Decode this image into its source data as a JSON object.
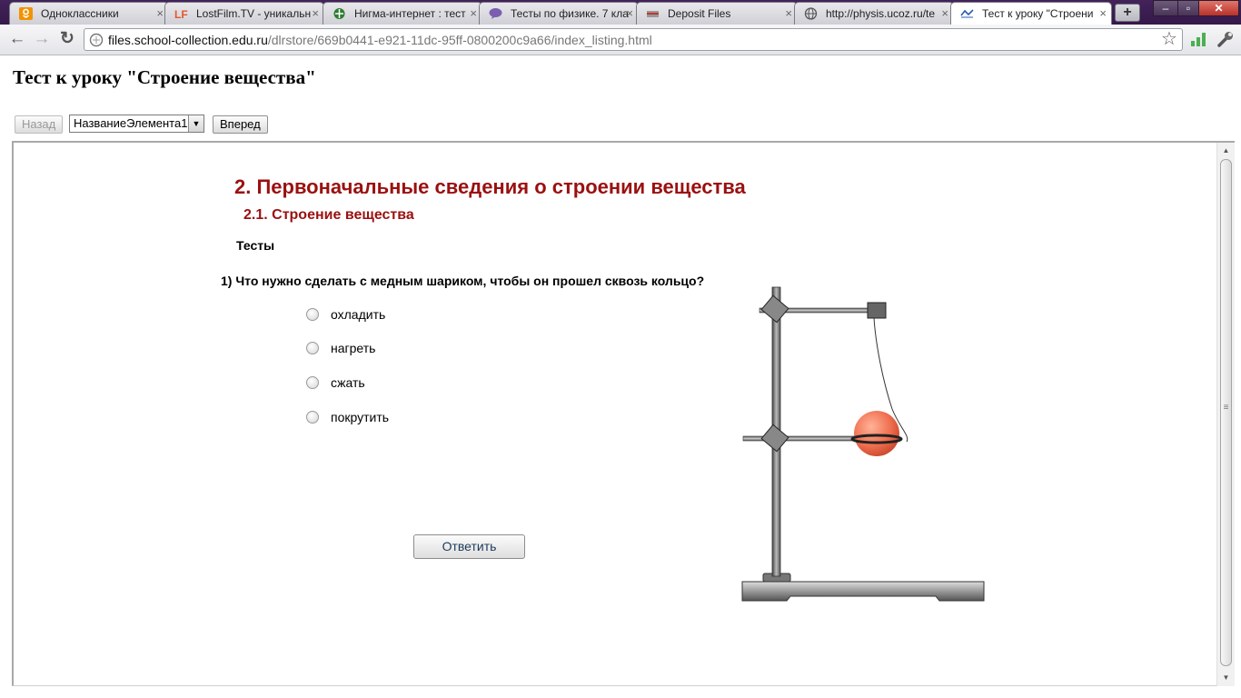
{
  "browser": {
    "tabs": [
      {
        "title": "Одноклассники",
        "icon": "odnoklassniki-icon"
      },
      {
        "title": "LostFilm.TV - уникальн",
        "icon": "lostfilm-icon"
      },
      {
        "title": "Нигма-интернет : тест",
        "icon": "nigma-icon"
      },
      {
        "title": "Тесты по физике. 7 кла",
        "icon": "chat-bubble-icon"
      },
      {
        "title": "Deposit Files",
        "icon": "deposit-files-icon"
      },
      {
        "title": "http://physis.ucoz.ru/te",
        "icon": "globe-icon"
      },
      {
        "title": "Тест к уроку \"Строени",
        "icon": "page-icon",
        "active": true
      }
    ],
    "tab_close_glyph": "×",
    "new_tab_glyph": "+",
    "window_controls": {
      "minimize": "–",
      "maximize": "▫",
      "close": "✕"
    },
    "nav": {
      "back": "←",
      "forward": "→",
      "reload": "↻"
    },
    "url": {
      "host": "files.school-collection.edu.ru",
      "path": "/dlrstore/669b0441-e921-11dc-95ff-0800200c9a66/index_listing.html"
    },
    "star": "☆",
    "wrench": "🔧"
  },
  "page": {
    "title": "Тест к уроку \"Строение вещества\"",
    "back_label": "Назад",
    "select_value": "НазваниеЭлемента1",
    "select_arrow": "▼",
    "forward_label": "Вперед"
  },
  "content": {
    "lesson_title": "2. Первоначальные сведения о строении вещества",
    "lesson_subtitle": "2.1. Строение вещества",
    "tests_label": "Тесты",
    "question": "1) Что нужно сделать с медным шариком, чтобы он прошел сквозь кольцо?",
    "options": [
      "охладить",
      "нагреть",
      "сжать",
      "покрутить"
    ],
    "answer_button": "Ответить"
  },
  "colors": {
    "heading": "#9b1010",
    "ball": "#f07050",
    "tab_strip": "#3a1c4f"
  },
  "scroll": {
    "up": "▲",
    "down": "▼",
    "grip": "≡"
  }
}
